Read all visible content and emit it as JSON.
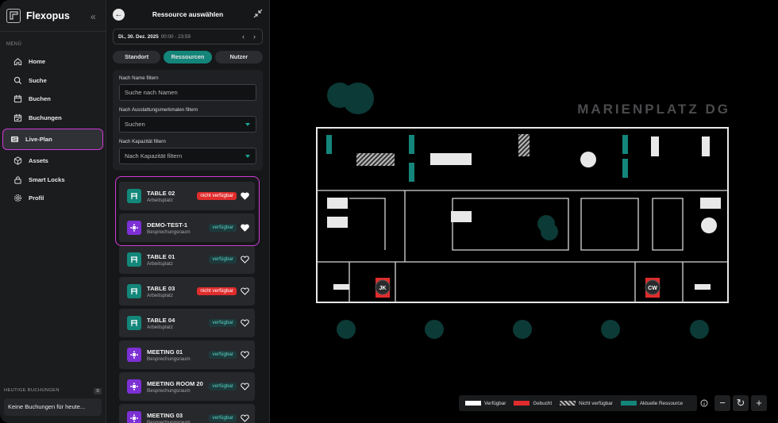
{
  "app": {
    "name": "Flexopus",
    "collapse_icon": "double-chevron-left-icon"
  },
  "sidebar": {
    "menu_title": "MENÜ",
    "items": [
      {
        "label": "Home",
        "icon": "home-icon"
      },
      {
        "label": "Suche",
        "icon": "search-icon"
      },
      {
        "label": "Buchen",
        "icon": "calendar-icon"
      },
      {
        "label": "Buchungen",
        "icon": "calendar-check-icon"
      },
      {
        "label": "Live-Plan",
        "icon": "map-icon",
        "active": true
      },
      {
        "label": "Assets",
        "icon": "box-icon"
      },
      {
        "label": "Smart Locks",
        "icon": "lock-icon"
      },
      {
        "label": "Profil",
        "icon": "gear-icon"
      }
    ],
    "today_title": "HEUTIGE BUCHUNGEN",
    "today_count": "0",
    "today_empty": "Keine Buchungen für heute..."
  },
  "panel": {
    "title": "Ressource auswählen",
    "date": "Di., 30. Dez. 2025",
    "time": "00:00 - 23:59",
    "tabs": [
      {
        "label": "Standort"
      },
      {
        "label": "Ressourcen",
        "active": true
      },
      {
        "label": "Nutzer"
      }
    ],
    "filters": {
      "name_label": "Nach Name filtern",
      "name_placeholder": "Suche nach Namen",
      "equip_label": "Nach Ausstattungsmerkmalen filtern",
      "equip_placeholder": "Suchen",
      "cap_label": "Nach Kapazität filtern",
      "cap_placeholder": "Nach Kapazität filtern"
    },
    "resources": [
      {
        "name": "TABLE 02",
        "type": "Arbeitsplatz",
        "kind": "table",
        "status": "nicht verfügbar",
        "available": false,
        "favorite": true
      },
      {
        "name": "DEMO-TEST-1",
        "type": "Besprechungsraum",
        "kind": "meeting",
        "status": "verfügbar",
        "available": true,
        "favorite": true
      },
      {
        "name": "TABLE 01",
        "type": "Arbeitsplatz",
        "kind": "table",
        "status": "verfügbar",
        "available": true,
        "favorite": false
      },
      {
        "name": "TABLE 03",
        "type": "Arbeitsplatz",
        "kind": "table",
        "status": "nicht verfügbar",
        "available": false,
        "favorite": false
      },
      {
        "name": "TABLE 04",
        "type": "Arbeitsplatz",
        "kind": "table",
        "status": "verfügbar",
        "available": true,
        "favorite": false
      },
      {
        "name": "MEETING 01",
        "type": "Besprechungsraum",
        "kind": "meeting",
        "status": "verfügbar",
        "available": true,
        "favorite": false
      },
      {
        "name": "MEETING ROOM 20",
        "type": "Besprechungsraum",
        "kind": "meeting",
        "status": "verfügbar",
        "available": true,
        "favorite": false
      },
      {
        "name": "MEETING 03",
        "type": "Besprechungsraum",
        "kind": "meeting",
        "status": "verfügbar",
        "available": true,
        "favorite": false
      }
    ]
  },
  "map": {
    "floor_title": "MARIENPLATZ DG",
    "markers": [
      {
        "initials": "JK"
      },
      {
        "initials": "CW"
      }
    ],
    "legend": [
      {
        "label": "Verfügbar",
        "color": "#ffffff"
      },
      {
        "label": "Gebucht",
        "color": "#e02c2c"
      },
      {
        "label": "Nicht verfügbar",
        "color": "striped"
      },
      {
        "label": "Aktuelle Ressource",
        "color": "#14857a"
      }
    ],
    "controls": [
      {
        "label": "−",
        "icon": "zoom-out-icon"
      },
      {
        "label": "↻",
        "icon": "reset-icon"
      },
      {
        "label": "+",
        "icon": "zoom-in-icon"
      }
    ]
  },
  "colors": {
    "accent": "#14857a",
    "meeting": "#7d30d5",
    "highlight": "#cf3ad6",
    "busy": "#e02c2c"
  }
}
